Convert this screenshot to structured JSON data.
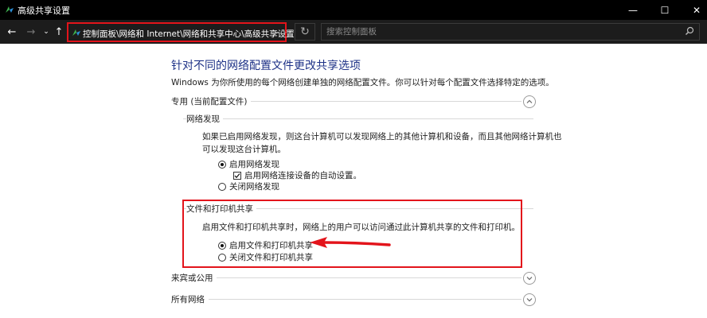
{
  "window": {
    "title": "高级共享设置",
    "minimize": "—",
    "maximize": "☐",
    "close": "✕"
  },
  "nav": {
    "back": "←",
    "forward": "→",
    "recent": "⌄",
    "up": "↑",
    "breadcrumb": "控制面板\\网络和 Internet\\网络和共享中心\\高级共享设置",
    "address_dropdown": "⌄",
    "refresh": "↻",
    "search_placeholder": "搜索控制面板"
  },
  "content": {
    "heading": "针对不同的网络配置文件更改共享选项",
    "intro": "Windows 为你所使用的每个网络创建单独的网络配置文件。你可以针对每个配置文件选择特定的选项。",
    "private_profile": {
      "title": "专用 (当前配置文件)",
      "network_discovery": {
        "title": "网络发现",
        "description_line1": "如果已启用网络发现，则这台计算机可以发现网络上的其他计算机和设备，而且其他网络计算机也",
        "description_line2": "可以发现这台计算机。",
        "option_on": "启用网络发现",
        "option_auto": "启用网络连接设备的自动设置。",
        "option_off": "关闭网络发现",
        "selected": "on",
        "auto_checked": true
      },
      "file_printer_sharing": {
        "title": "文件和打印机共享",
        "description": "启用文件和打印机共享时，网络上的用户可以访问通过此计算机共享的文件和打印机。",
        "option_on": "启用文件和打印机共享",
        "option_off": "关闭文件和打印机共享",
        "selected": "on"
      }
    },
    "guest_public": {
      "title": "来宾或公用"
    },
    "all_networks": {
      "title": "所有网络"
    }
  },
  "colors": {
    "heading": "#1e3287",
    "annotation_red": "#e3141b",
    "titlebar": "#000000"
  }
}
